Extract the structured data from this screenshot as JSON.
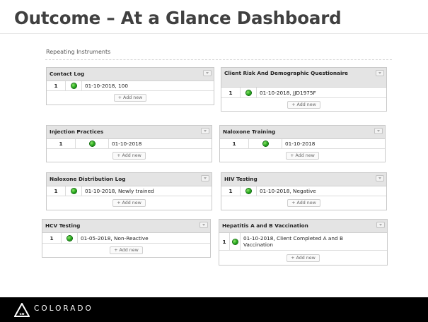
{
  "slide": {
    "title": "Outcome – At a Glance Dashboard",
    "section_label": "Repeating Instruments",
    "add_new_label": "+ Add new",
    "footer_brand": "COLORADO",
    "status_color": "#1a9e12",
    "footer_color": "#000000"
  },
  "panels": {
    "contact_log": {
      "title": "Contact Log",
      "rows": [
        {
          "num": "1",
          "value": "01-10-2018, 100"
        }
      ]
    },
    "client_risk": {
      "title": "Client Risk And Demographic Questionaire",
      "rows": [
        {
          "num": "1",
          "value": "01-10-2018, JJD1975F"
        }
      ]
    },
    "injection_practices": {
      "title": "Injection Practices",
      "rows": [
        {
          "num": "1",
          "value": "01-10-2018"
        }
      ]
    },
    "naloxone_training": {
      "title": "Naloxone Training",
      "rows": [
        {
          "num": "1",
          "value": "01-10-2018"
        }
      ]
    },
    "naloxone_distribution": {
      "title": "Naloxone Distribution Log",
      "rows": [
        {
          "num": "1",
          "value": "01-10-2018, Newly trained"
        }
      ]
    },
    "hiv_testing": {
      "title": "HIV Testing",
      "rows": [
        {
          "num": "1",
          "value": "01-10-2018, Negative"
        }
      ]
    },
    "hcv_testing": {
      "title": "HCV Testing",
      "rows": [
        {
          "num": "1",
          "value": "01-05-2018, Non-Reactive"
        }
      ]
    },
    "hepatitis_ab": {
      "title": "Hepatitis A and B Vaccination",
      "rows": [
        {
          "num": "1",
          "value": "01-10-2018, Client Completed A and B Vaccination"
        }
      ]
    }
  }
}
